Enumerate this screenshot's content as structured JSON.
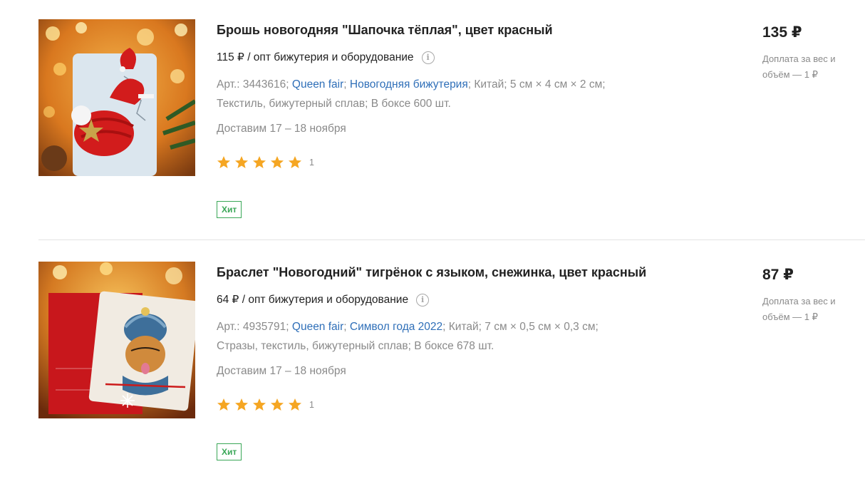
{
  "products": [
    {
      "title": "Брошь новогодняя \"Шапочка тёплая\", цвет красный",
      "wholesale_price": "115 ₽",
      "wholesale_label": " / опт бижутерия и оборудование",
      "info_icon": "info-icon",
      "article": "Арт.: 3443616;",
      "brand": "Queen fair",
      "category": "Новогодняя бижутерия",
      "country": "Китай;",
      "dimensions": "5 см × 4 см × 2 см;",
      "material": "Текстиль, бижутерный сплав;",
      "box_count": "В боксе 600 шт.",
      "delivery": "Доставим 17 – 18 ноября",
      "rating": 5,
      "rating_count": "1",
      "badge": "Хит",
      "price": "135 ₽",
      "surcharge": "Доплата за вес и объём — 1 ₽"
    },
    {
      "title": "Браслет \"Новогодний\" тигрёнок с языком, снежинка, цвет красный",
      "wholesale_price": "64 ₽",
      "wholesale_label": " / опт бижутерия и оборудование",
      "info_icon": "info-icon",
      "article": "Арт.: 4935791;",
      "brand": "Queen fair",
      "category": "Символ года 2022",
      "country": "Китай;",
      "dimensions": "7 см × 0,5 см × 0,3 см;",
      "material": "Стразы, текстиль, бижутерный сплав;",
      "box_count": "В боксе 678 шт.",
      "delivery": "Доставим 17 – 18 ноября",
      "rating": 5,
      "rating_count": "1",
      "badge": "Хит",
      "price": "87 ₽",
      "surcharge": "Доплата за вес и объём — 1 ₽"
    }
  ],
  "colors": {
    "link": "#2f6fb8",
    "muted": "#8a8a8a",
    "star": "#f5a623",
    "badge": "#3aa757"
  }
}
